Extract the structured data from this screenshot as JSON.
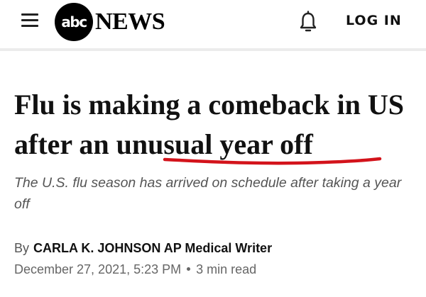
{
  "header": {
    "menu_icon": "hamburger-menu-icon",
    "logo": {
      "abc": "abc",
      "news": "NEWS"
    },
    "notification_icon": "bell-icon",
    "login_label": "LOG IN"
  },
  "article": {
    "headline_part1": "Flu is making a comeback in US after an ",
    "headline_underlined": "unusual year off",
    "highlight_color": "#d3131b",
    "subheadline": "The U.S. flu season has arrived on schedule after taking a year off",
    "byline_prefix": "By",
    "author": "CARLA K. JOHNSON AP Medical Writer",
    "date": "December 27, 2021, 5:23 PM",
    "read_time": "3 min read"
  }
}
